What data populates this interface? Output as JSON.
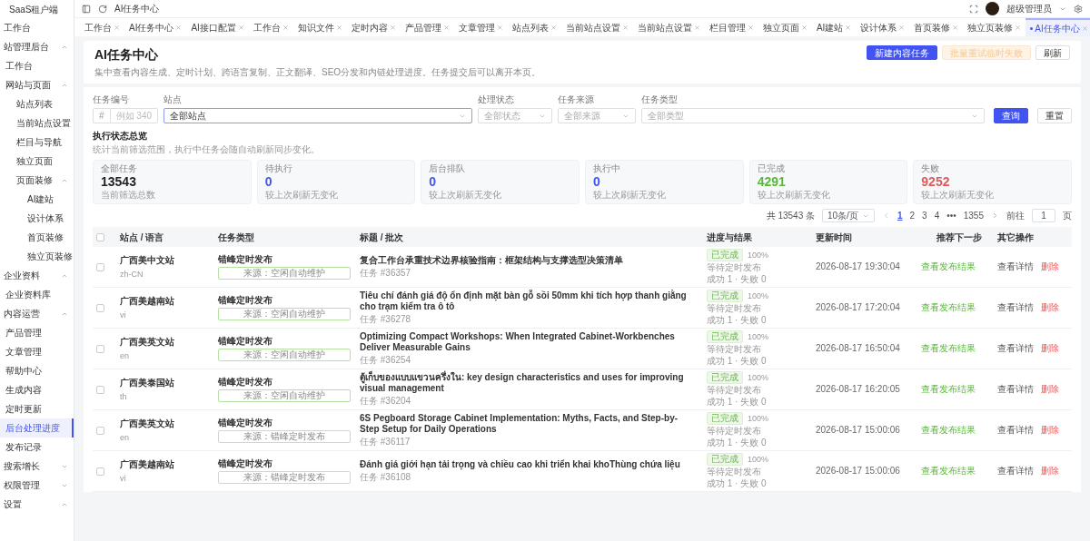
{
  "sidebar": {
    "brand": "SaaS租户端",
    "items": [
      {
        "label": "工作台",
        "selected": false
      },
      {
        "label": "站管理后台",
        "selected": false,
        "expanded": true,
        "children": [
          {
            "label": "工作台",
            "selected": false
          },
          {
            "label": "网站与页面",
            "selected": false,
            "expanded": true,
            "children": [
              {
                "label": "站点列表",
                "selected": false
              },
              {
                "label": "当前站点设置",
                "selected": false
              },
              {
                "label": "栏目与导航",
                "selected": false
              },
              {
                "label": "独立页面",
                "selected": false
              },
              {
                "label": "页面装修",
                "selected": false,
                "expanded": true,
                "children": [
                  {
                    "label": "AI建站",
                    "selected": false
                  },
                  {
                    "label": "设计体系",
                    "selected": false
                  },
                  {
                    "label": "首页装修",
                    "selected": false
                  },
                  {
                    "label": "独立页装修",
                    "selected": false
                  }
                ]
              }
            ]
          }
        ]
      },
      {
        "label": "企业资料",
        "selected": false,
        "expanded": true,
        "children": [
          {
            "label": "企业资料库",
            "selected": false
          }
        ]
      },
      {
        "label": "内容运营",
        "selected": false,
        "expanded": true,
        "children": [
          {
            "label": "产品管理",
            "selected": false
          },
          {
            "label": "文章管理",
            "selected": false
          },
          {
            "label": "帮助中心",
            "selected": false
          },
          {
            "label": "生成内容",
            "selected": false
          },
          {
            "label": "定时更新",
            "selected": false
          },
          {
            "label": "后台处理进度",
            "selected": true
          },
          {
            "label": "发布记录",
            "selected": false
          }
        ]
      },
      {
        "label": "搜索增长",
        "selected": false,
        "expanded": false
      },
      {
        "label": "权限管理",
        "selected": false,
        "expanded": false
      },
      {
        "label": "设置",
        "selected": false,
        "expanded": true
      }
    ]
  },
  "topbar": {
    "breadcrumb": "AI任务中心",
    "user": "超级管理员"
  },
  "tabs": [
    {
      "label": "工作台",
      "selected": false
    },
    {
      "label": "AI任务中心",
      "selected": false
    },
    {
      "label": "AI接口配置",
      "selected": false
    },
    {
      "label": "工作台",
      "selected": false
    },
    {
      "label": "知识文件",
      "selected": false
    },
    {
      "label": "定时内容",
      "selected": false
    },
    {
      "label": "产品管理",
      "selected": false
    },
    {
      "label": "文章管理",
      "selected": false
    },
    {
      "label": "站点列表",
      "selected": false
    },
    {
      "label": "当前站点设置",
      "selected": false
    },
    {
      "label": "当前站点设置",
      "selected": false
    },
    {
      "label": "栏目管理",
      "selected": false
    },
    {
      "label": "独立页面",
      "selected": false
    },
    {
      "label": "AI建站",
      "selected": false
    },
    {
      "label": "设计体系",
      "selected": false
    },
    {
      "label": "首页装修",
      "selected": false
    },
    {
      "label": "独立页装修",
      "selected": false
    },
    {
      "label": "AI任务中心",
      "selected": true
    }
  ],
  "header": {
    "title": "AI任务中心",
    "subtitle": "集中查看内容生成、定时计划、跨语言复制、正文翻译、SEO分发和内链处理进度。任务提交后可以离开本页。",
    "buttons": [
      {
        "label": "新建内容任务",
        "kind": "primary"
      },
      {
        "label": "批量重试临时失败",
        "kind": "warning-disabled"
      },
      {
        "label": "刷新",
        "kind": "default"
      }
    ]
  },
  "filters": {
    "fields": [
      {
        "label": "任务编号",
        "kind": "number",
        "prefix": "#",
        "placeholder": "例如 340"
      },
      {
        "label": "站点",
        "kind": "select",
        "value": "全部站点",
        "focused": true
      },
      {
        "label": "处理状态",
        "kind": "select",
        "placeholder": "全部状态",
        "focused": false
      },
      {
        "label": "任务来源",
        "kind": "select",
        "placeholder": "全部来源",
        "focused": false
      },
      {
        "label": "任务类型",
        "kind": "select",
        "placeholder": "全部类型",
        "focused": false
      }
    ],
    "buttons": [
      {
        "label": "查询",
        "kind": "primary"
      },
      {
        "label": "重置",
        "kind": "default"
      }
    ]
  },
  "overview": {
    "title": "执行状态总览",
    "description": "统计当前筛选范围，执行中任务会随自动刷新同步变化。",
    "stats": [
      {
        "label": "全部任务",
        "value": "13543",
        "note": "当前筛选总数",
        "kind": "neutral"
      },
      {
        "label": "待执行",
        "value": "0",
        "note": "较上次刷新无变化",
        "kind": "info"
      },
      {
        "label": "后台排队",
        "value": "0",
        "note": "较上次刷新无变化",
        "kind": "info"
      },
      {
        "label": "执行中",
        "value": "0",
        "note": "较上次刷新无变化",
        "kind": "info"
      },
      {
        "label": "已完成",
        "value": "4291",
        "note": "较上次刷新无变化",
        "kind": "success"
      },
      {
        "label": "失败",
        "value": "9252",
        "note": "较上次刷新无变化",
        "kind": "danger"
      }
    ]
  },
  "pagination": {
    "total": "共 13543 条",
    "page_size": "10条/页",
    "pages": [
      {
        "label": "1",
        "kind": "page",
        "selected": true
      },
      {
        "label": "2",
        "kind": "page",
        "selected": false
      },
      {
        "label": "3",
        "kind": "page",
        "selected": false
      },
      {
        "label": "4",
        "kind": "page",
        "selected": false
      },
      {
        "label": "•••",
        "kind": "ellipsis"
      },
      {
        "label": "1355",
        "kind": "page",
        "selected": false
      }
    ],
    "goto_label": "前往",
    "goto_value": "1",
    "goto_suffix": "页"
  },
  "table": {
    "select_all": {
      "checked": false
    },
    "columns": [
      "站点 / 语言",
      "任务类型",
      "标题 / 批次",
      "进度与结果",
      "更新时间",
      "推荐下一步",
      "其它操作"
    ],
    "rows": [
      {
        "checked": false,
        "site": "广西美中文站",
        "lang": "zh-CN",
        "type": "错峰定时发布",
        "source": {
          "text": "来源：空闲自动维护",
          "color": "#b7e0a5"
        },
        "title": "复合工作台承重技术边界核验指南：框架结构与支撑选型决策清单",
        "task": "任务 #36357",
        "status": "已完成",
        "percent": "100%",
        "note": "等待定时发布",
        "result": "成功 1 · 失败 0",
        "time": "2026-08-17 19:30:04",
        "next": "查看发布结果",
        "actions": [
          {
            "label": "查看详情",
            "kind": "default"
          },
          {
            "label": "删除",
            "kind": "danger"
          }
        ]
      },
      {
        "checked": false,
        "site": "广西美越南站",
        "lang": "vi",
        "type": "错峰定时发布",
        "source": {
          "text": "来源：空闲自动维护",
          "color": "#b7e0a5"
        },
        "title": "Tiêu chí đánh giá độ ổn định mặt bàn gỗ sồi 50mm khi tích hợp thanh giằng cho trạm kiểm tra ô tô",
        "task": "任务 #36278",
        "status": "已完成",
        "percent": "100%",
        "note": "等待定时发布",
        "result": "成功 1 · 失败 0",
        "time": "2026-08-17 17:20:04",
        "next": "查看发布结果",
        "actions": [
          {
            "label": "查看详情",
            "kind": "default"
          },
          {
            "label": "删除",
            "kind": "danger"
          }
        ]
      },
      {
        "checked": false,
        "site": "广西美英文站",
        "lang": "en",
        "type": "错峰定时发布",
        "source": {
          "text": "来源：空闲自动维护",
          "color": "#b7e0a5"
        },
        "title": "Optimizing Compact Workshops: When Integrated Cabinet-Workbenches Deliver Measurable Gains",
        "task": "任务 #36254",
        "status": "已完成",
        "percent": "100%",
        "note": "等待定时发布",
        "result": "成功 1 · 失败 0",
        "time": "2026-08-17 16:50:04",
        "next": "查看发布结果",
        "actions": [
          {
            "label": "查看详情",
            "kind": "default"
          },
          {
            "label": "删除",
            "kind": "danger"
          }
        ]
      },
      {
        "checked": false,
        "site": "广西美泰国站",
        "lang": "th",
        "type": "错峰定时发布",
        "source": {
          "text": "来源：空闲自动维护",
          "color": "#b7e0a5"
        },
        "title": "ตู้เก็บของแบบแขวนครึ่งใน: key design characteristics and uses for improving visual management",
        "task": "任务 #36204",
        "status": "已完成",
        "percent": "100%",
        "note": "等待定时发布",
        "result": "成功 1 · 失败 0",
        "time": "2026-08-17 16:20:05",
        "next": "查看发布结果",
        "actions": [
          {
            "label": "查看详情",
            "kind": "default"
          },
          {
            "label": "删除",
            "kind": "danger"
          }
        ]
      },
      {
        "checked": false,
        "site": "广西美英文站",
        "lang": "en",
        "type": "错峰定时发布",
        "source": {
          "text": "来源：错峰定时发布",
          "color": "#d4d4d4"
        },
        "title": "6S Pegboard Storage Cabinet Implementation: Myths, Facts, and Step-by-Step Setup for Daily Operations",
        "task": "任务 #36117",
        "status": "已完成",
        "percent": "100%",
        "note": "等待定时发布",
        "result": "成功 1 · 失败 0",
        "time": "2026-08-17 15:00:06",
        "next": "查看发布结果",
        "actions": [
          {
            "label": "查看详情",
            "kind": "default"
          },
          {
            "label": "删除",
            "kind": "danger"
          }
        ]
      },
      {
        "checked": false,
        "site": "广西美越南站",
        "lang": "vi",
        "type": "错峰定时发布",
        "source": {
          "text": "来源：错峰定时发布",
          "color": "#d4d4d4"
        },
        "title": "Đánh giá giới hạn tải trọng và chiều cao khi triển khai khoThùng chứa liệu",
        "task": "任务 #36108",
        "status": "已完成",
        "percent": "100%",
        "note": "等待定时发布",
        "result": "成功 1 · 失败 0",
        "time": "2026-08-17 15:00:06",
        "next": "查看发布结果",
        "actions": [
          {
            "label": "查看详情",
            "kind": "default"
          },
          {
            "label": "删除",
            "kind": "danger"
          }
        ]
      }
    ]
  }
}
